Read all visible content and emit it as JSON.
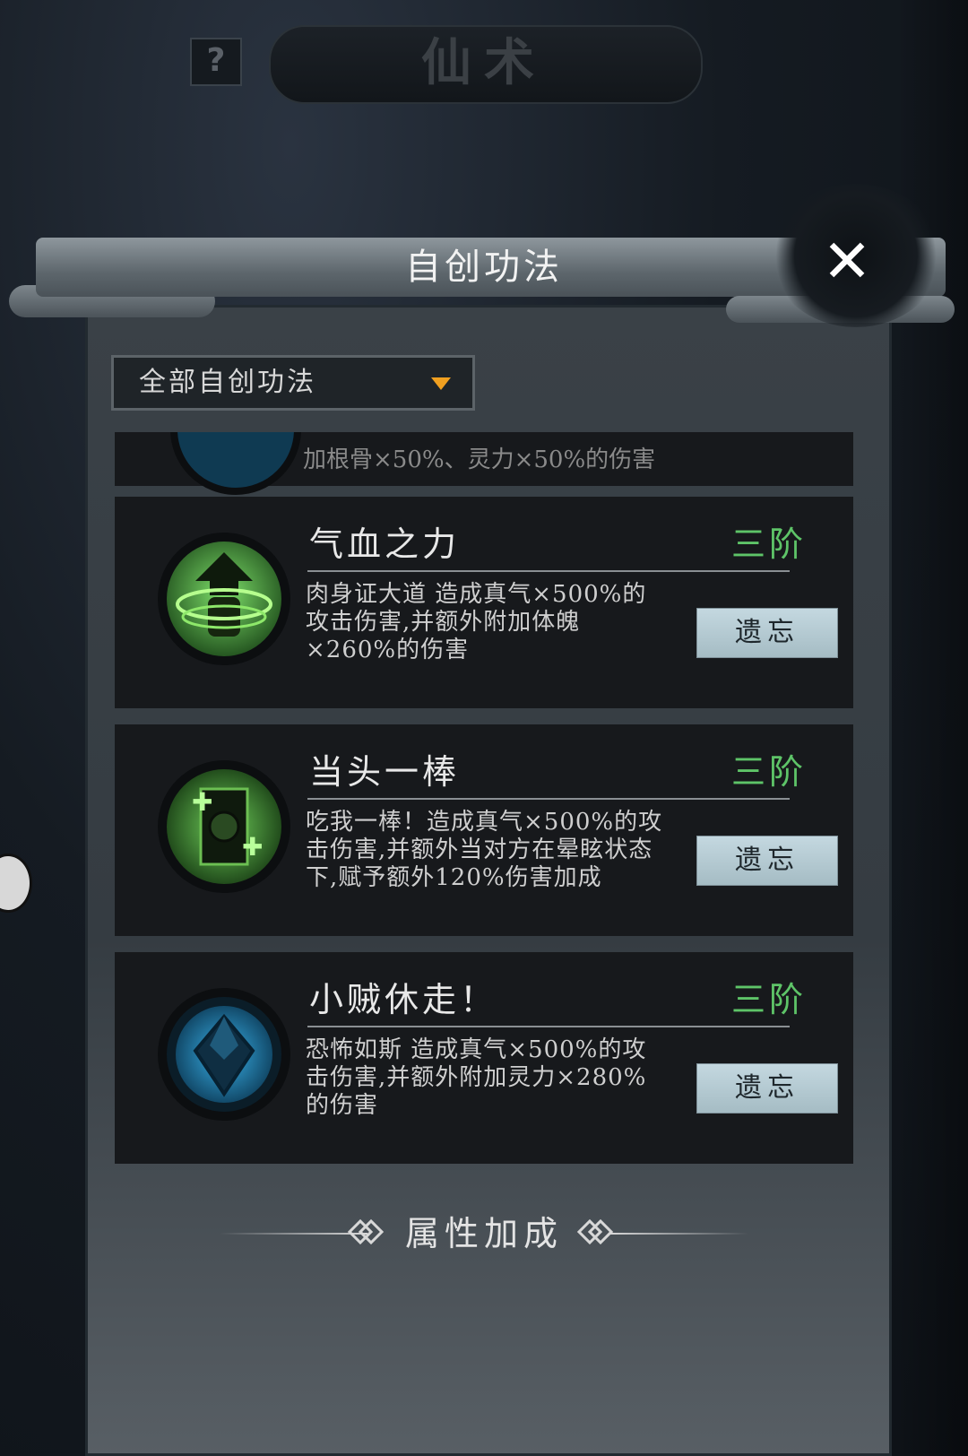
{
  "background": {
    "help_label": "?",
    "title": "仙术"
  },
  "panel": {
    "title": "自创功法",
    "close_label": "✕"
  },
  "filter": {
    "selected": "全部自创功法"
  },
  "partial_card": {
    "desc": "加根骨×50%、灵力×50%的伤害"
  },
  "skills": [
    {
      "name": "气血之力",
      "tier": "三阶",
      "desc": "肉身证大道 造成真气×500%的攻击伤害,并额外附加体魄×260%的伤害",
      "button": "遗忘",
      "icon": "fist-icon",
      "color": "#5ec468"
    },
    {
      "name": "当头一棒",
      "tier": "三阶",
      "desc": "吃我一棒！造成真气×500%的攻击伤害,并额外当对方在晕眩状态下,赋予额外120%伤害加成",
      "button": "遗忘",
      "icon": "staff-strike-icon",
      "color": "#5ec468"
    },
    {
      "name": "小贼休走！",
      "tier": "三阶",
      "desc": "恐怖如斯 造成真气×500%的攻击伤害,并额外附加灵力×280%的伤害",
      "button": "遗忘",
      "icon": "blue-crystal-icon",
      "color": "#2aa8e0"
    }
  ],
  "attributes": {
    "title": "属性加成"
  }
}
